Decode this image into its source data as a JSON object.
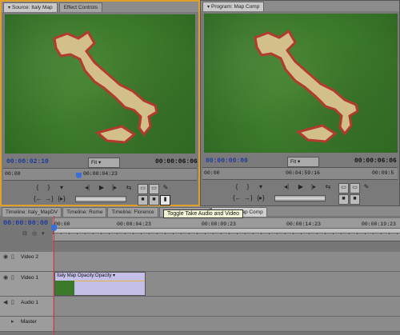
{
  "source_monitor": {
    "tabs": [
      {
        "label": "Source: Italy Map"
      },
      {
        "label": "Effect Controls"
      }
    ],
    "timecode_current": "00:00:02:10",
    "timecode_duration": "00:00:06:06",
    "fit_label": "Fit",
    "ruler_left": "00:00",
    "ruler_mid": "00:00:04:23"
  },
  "program_monitor": {
    "tab_label": "Program: Map Comp",
    "timecode_current": "00:00:00:00",
    "timecode_duration": "00:00:06:06",
    "fit_label": "Fit",
    "ruler_left": "00:00",
    "ruler_mid": "00:04:59:16",
    "ruler_right": "00:09:5"
  },
  "tooltip": "Toggle Take Audio and Video",
  "timeline": {
    "tabs": [
      {
        "label": "Timeline: Italy_MapDV"
      },
      {
        "label": "Timeline: Rome"
      },
      {
        "label": "Timeline: Florence"
      },
      {
        "label": "Timeline: Italy Map"
      },
      {
        "label": "Timeline: Map Comp"
      }
    ],
    "timecode": "00:00:00:00",
    "ruler_ticks": [
      "00:00",
      "00:00:04:23",
      "00:00:09:23",
      "00:00:14:23",
      "00:00:19:23"
    ],
    "tracks": [
      {
        "name": "Video 2"
      },
      {
        "name": "Video 1"
      },
      {
        "name": "Audio 1"
      },
      {
        "name": "Master"
      }
    ],
    "clip_label": "Italy Map",
    "clip_effect_label": "Opacity:Opacity"
  },
  "colors": {
    "source_border": "#e0a02a",
    "timecode_blue": "#1d3b9c",
    "playhead": "#dd3333",
    "clip_fill": "#c3bfe6",
    "map_land": "#d2bf8a",
    "map_outline": "#b23a2e",
    "viewer_green": "#3b7a2a"
  }
}
